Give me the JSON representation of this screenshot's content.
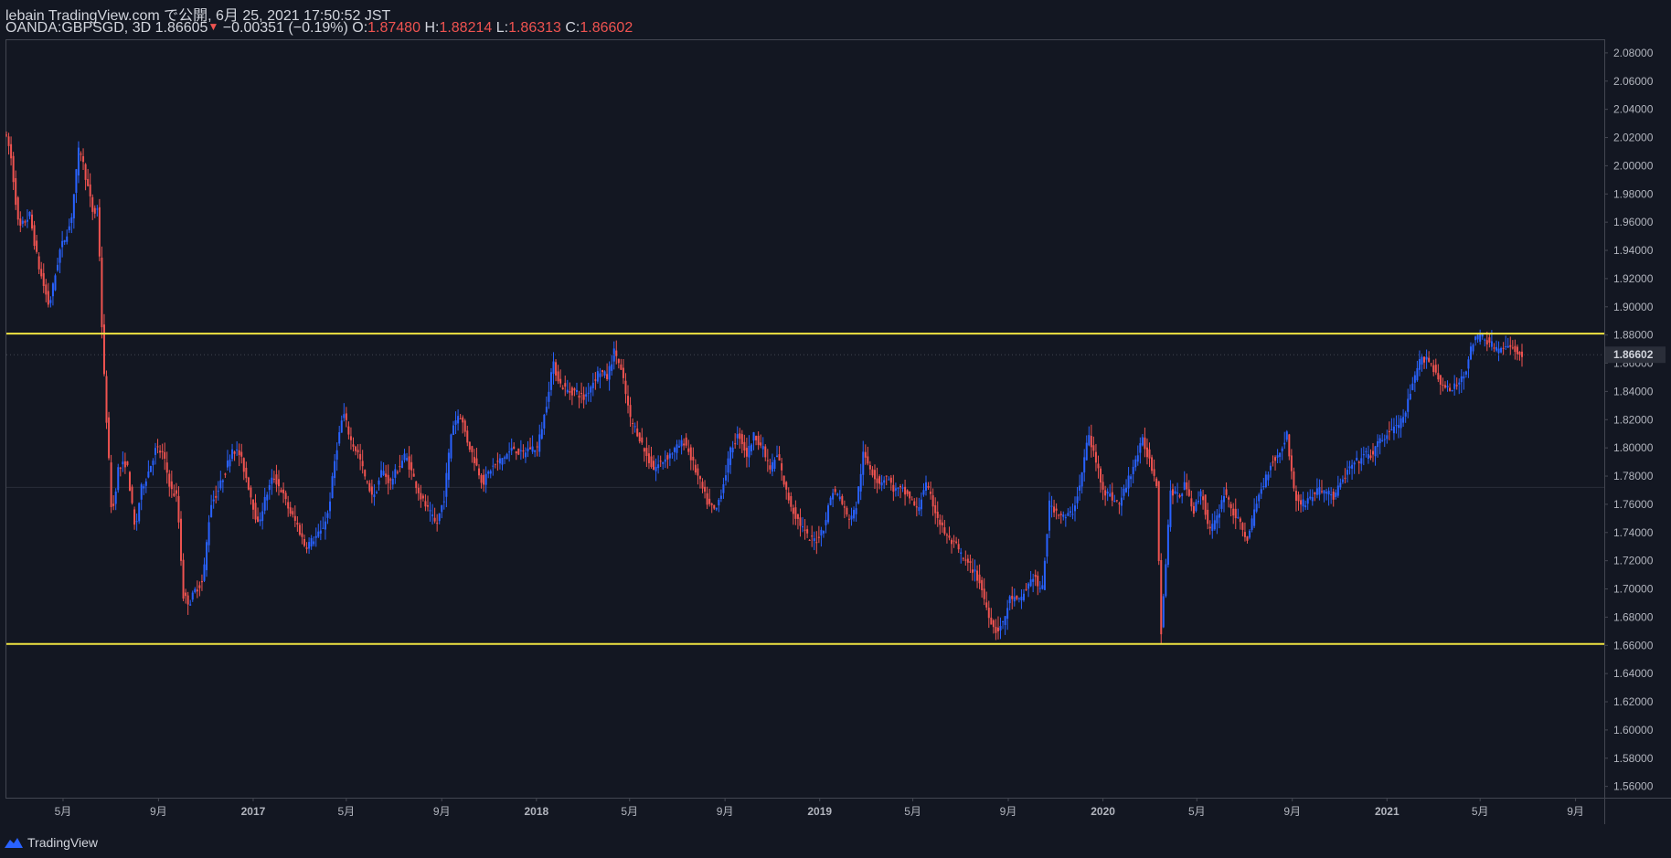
{
  "header": {
    "publish_line": "lebain TradingView.com で公開, 6月 25, 2021 17:50:52 JST",
    "symbol": "OANDA:GBPSGD, 3D",
    "last": "1.86605",
    "change": "−0.00351 (−0.19%)",
    "o_label": "O:",
    "o_value": "1.87480",
    "h_label": "H:",
    "h_value": "1.88214",
    "l_label": "L:",
    "l_value": "1.86313",
    "c_label": "C:",
    "c_value": "1.86602"
  },
  "footer": {
    "brand": "TradingView",
    "logo_icon": "tradingview-logo-icon"
  },
  "colors": {
    "background": "#131722",
    "up": "#2962ff",
    "down": "#ef5350",
    "level_line": "#f0e442",
    "text": "#d1d4dc",
    "border": "#434651"
  },
  "chart_data": {
    "type": "candlestick",
    "symbol": "OANDA:GBPSGD",
    "interval": "3D",
    "ylim": [
      1.552,
      2.089
    ],
    "y_ticks": [
      "2.08000",
      "2.06000",
      "2.04000",
      "2.02000",
      "2.00000",
      "1.98000",
      "1.96000",
      "1.94000",
      "1.92000",
      "1.90000",
      "1.88000",
      "1.86000",
      "1.84000",
      "1.82000",
      "1.80000",
      "1.78000",
      "1.76000",
      "1.74000",
      "1.72000",
      "1.70000",
      "1.68000",
      "1.66000",
      "1.64000",
      "1.62000",
      "1.60000",
      "1.58000",
      "1.56000"
    ],
    "x_ticks": [
      {
        "label": "5月",
        "date": "2016-05-01"
      },
      {
        "label": "9月",
        "date": "2016-09-01"
      },
      {
        "label": "2017",
        "date": "2017-01-01"
      },
      {
        "label": "5月",
        "date": "2017-05-01"
      },
      {
        "label": "9月",
        "date": "2017-09-01"
      },
      {
        "label": "2018",
        "date": "2018-01-01"
      },
      {
        "label": "5月",
        "date": "2018-05-01"
      },
      {
        "label": "9月",
        "date": "2018-09-01"
      },
      {
        "label": "2019",
        "date": "2019-01-01"
      },
      {
        "label": "5月",
        "date": "2019-05-01"
      },
      {
        "label": "9月",
        "date": "2019-09-01"
      },
      {
        "label": "2020",
        "date": "2020-01-01"
      },
      {
        "label": "5月",
        "date": "2020-05-01"
      },
      {
        "label": "9月",
        "date": "2020-09-01"
      },
      {
        "label": "2021",
        "date": "2021-01-01"
      },
      {
        "label": "5月",
        "date": "2021-05-01"
      },
      {
        "label": "9月",
        "date": "2021-09-01"
      }
    ],
    "x_range": [
      "2016-02-18",
      "2021-10-08"
    ],
    "last_date": "2021-06-25",
    "last_price_label": "1.86602",
    "horizontal_lines": [
      1.881,
      1.661
    ],
    "price_path": [
      [
        "2016-02-18",
        2.025
      ],
      [
        "2016-02-26",
        2.01
      ],
      [
        "2016-03-08",
        1.955
      ],
      [
        "2016-03-22",
        1.965
      ],
      [
        "2016-04-02",
        1.93
      ],
      [
        "2016-04-16",
        1.9
      ],
      [
        "2016-04-30",
        1.94
      ],
      [
        "2016-05-14",
        1.96
      ],
      [
        "2016-05-25",
        2.015
      ],
      [
        "2016-06-03",
        1.99
      ],
      [
        "2016-06-12",
        1.965
      ],
      [
        "2016-06-18",
        1.97
      ],
      [
        "2016-06-24",
        1.87
      ],
      [
        "2016-06-30",
        1.81
      ],
      [
        "2016-07-06",
        1.75
      ],
      [
        "2016-07-14",
        1.785
      ],
      [
        "2016-07-25",
        1.79
      ],
      [
        "2016-08-05",
        1.74
      ],
      [
        "2016-08-12",
        1.77
      ],
      [
        "2016-08-20",
        1.78
      ],
      [
        "2016-09-01",
        1.8
      ],
      [
        "2016-09-10",
        1.795
      ],
      [
        "2016-09-20",
        1.77
      ],
      [
        "2016-09-28",
        1.765
      ],
      [
        "2016-10-06",
        1.695
      ],
      [
        "2016-10-14",
        1.69
      ],
      [
        "2016-10-22",
        1.7
      ],
      [
        "2016-10-31",
        1.705
      ],
      [
        "2016-11-10",
        1.76
      ],
      [
        "2016-11-20",
        1.77
      ],
      [
        "2016-11-30",
        1.785
      ],
      [
        "2016-12-08",
        1.8
      ],
      [
        "2016-12-18",
        1.795
      ],
      [
        "2016-12-28",
        1.775
      ],
      [
        "2017-01-10",
        1.745
      ],
      [
        "2017-01-20",
        1.765
      ],
      [
        "2017-01-30",
        1.78
      ],
      [
        "2017-02-09",
        1.77
      ],
      [
        "2017-02-20",
        1.755
      ],
      [
        "2017-03-02",
        1.745
      ],
      [
        "2017-03-12",
        1.73
      ],
      [
        "2017-03-22",
        1.735
      ],
      [
        "2017-04-01",
        1.74
      ],
      [
        "2017-04-11",
        1.755
      ],
      [
        "2017-04-20",
        1.795
      ],
      [
        "2017-04-30",
        1.825
      ],
      [
        "2017-05-10",
        1.805
      ],
      [
        "2017-05-20",
        1.795
      ],
      [
        "2017-05-30",
        1.775
      ],
      [
        "2017-06-09",
        1.765
      ],
      [
        "2017-06-19",
        1.785
      ],
      [
        "2017-06-29",
        1.775
      ],
      [
        "2017-07-09",
        1.785
      ],
      [
        "2017-07-19",
        1.795
      ],
      [
        "2017-07-29",
        1.78
      ],
      [
        "2017-08-08",
        1.765
      ],
      [
        "2017-08-18",
        1.755
      ],
      [
        "2017-08-28",
        1.745
      ],
      [
        "2017-09-07",
        1.765
      ],
      [
        "2017-09-17",
        1.815
      ],
      [
        "2017-09-27",
        1.825
      ],
      [
        "2017-10-07",
        1.805
      ],
      [
        "2017-10-17",
        1.79
      ],
      [
        "2017-10-27",
        1.775
      ],
      [
        "2017-11-06",
        1.785
      ],
      [
        "2017-11-16",
        1.79
      ],
      [
        "2017-11-26",
        1.795
      ],
      [
        "2017-12-06",
        1.8
      ],
      [
        "2017-12-16",
        1.795
      ],
      [
        "2017-12-26",
        1.8
      ],
      [
        "2018-01-05",
        1.8
      ],
      [
        "2018-01-15",
        1.825
      ],
      [
        "2018-01-25",
        1.86
      ],
      [
        "2018-02-04",
        1.845
      ],
      [
        "2018-02-14",
        1.84
      ],
      [
        "2018-02-24",
        1.84
      ],
      [
        "2018-03-06",
        1.835
      ],
      [
        "2018-03-16",
        1.845
      ],
      [
        "2018-03-26",
        1.855
      ],
      [
        "2018-04-05",
        1.85
      ],
      [
        "2018-04-15",
        1.87
      ],
      [
        "2018-04-25",
        1.85
      ],
      [
        "2018-05-05",
        1.82
      ],
      [
        "2018-05-15",
        1.81
      ],
      [
        "2018-05-25",
        1.795
      ],
      [
        "2018-06-04",
        1.785
      ],
      [
        "2018-06-14",
        1.79
      ],
      [
        "2018-06-24",
        1.795
      ],
      [
        "2018-07-04",
        1.8
      ],
      [
        "2018-07-14",
        1.805
      ],
      [
        "2018-07-24",
        1.79
      ],
      [
        "2018-08-03",
        1.775
      ],
      [
        "2018-08-13",
        1.76
      ],
      [
        "2018-08-23",
        1.755
      ],
      [
        "2018-09-02",
        1.775
      ],
      [
        "2018-09-12",
        1.8
      ],
      [
        "2018-09-22",
        1.81
      ],
      [
        "2018-10-02",
        1.795
      ],
      [
        "2018-10-12",
        1.81
      ],
      [
        "2018-10-22",
        1.8
      ],
      [
        "2018-11-01",
        1.785
      ],
      [
        "2018-11-11",
        1.795
      ],
      [
        "2018-11-21",
        1.77
      ],
      [
        "2018-12-01",
        1.755
      ],
      [
        "2018-12-11",
        1.745
      ],
      [
        "2018-12-21",
        1.735
      ],
      [
        "2018-12-31",
        1.735
      ],
      [
        "2019-01-10",
        1.745
      ],
      [
        "2019-01-20",
        1.77
      ],
      [
        "2019-01-30",
        1.765
      ],
      [
        "2019-02-09",
        1.75
      ],
      [
        "2019-02-19",
        1.755
      ],
      [
        "2019-03-01",
        1.795
      ],
      [
        "2019-03-11",
        1.785
      ],
      [
        "2019-03-21",
        1.775
      ],
      [
        "2019-03-31",
        1.78
      ],
      [
        "2019-04-10",
        1.77
      ],
      [
        "2019-04-20",
        1.77
      ],
      [
        "2019-04-30",
        1.765
      ],
      [
        "2019-05-10",
        1.755
      ],
      [
        "2019-05-20",
        1.775
      ],
      [
        "2019-05-30",
        1.76
      ],
      [
        "2019-06-09",
        1.745
      ],
      [
        "2019-06-19",
        1.735
      ],
      [
        "2019-06-29",
        1.73
      ],
      [
        "2019-07-09",
        1.72
      ],
      [
        "2019-07-19",
        1.715
      ],
      [
        "2019-07-29",
        1.705
      ],
      [
        "2019-08-08",
        1.685
      ],
      [
        "2019-08-18",
        1.67
      ],
      [
        "2019-08-28",
        1.675
      ],
      [
        "2019-09-07",
        1.695
      ],
      [
        "2019-09-17",
        1.69
      ],
      [
        "2019-09-27",
        1.7
      ],
      [
        "2019-10-07",
        1.71
      ],
      [
        "2019-10-17",
        1.695
      ],
      [
        "2019-10-27",
        1.76
      ],
      [
        "2019-11-06",
        1.755
      ],
      [
        "2019-11-16",
        1.75
      ],
      [
        "2019-11-26",
        1.755
      ],
      [
        "2019-12-06",
        1.775
      ],
      [
        "2019-12-16",
        1.81
      ],
      [
        "2019-12-26",
        1.79
      ],
      [
        "2020-01-05",
        1.77
      ],
      [
        "2020-01-15",
        1.765
      ],
      [
        "2020-01-25",
        1.76
      ],
      [
        "2020-02-04",
        1.775
      ],
      [
        "2020-02-14",
        1.79
      ],
      [
        "2020-02-24",
        1.805
      ],
      [
        "2020-03-05",
        1.79
      ],
      [
        "2020-03-13",
        1.775
      ],
      [
        "2020-03-19",
        1.67
      ],
      [
        "2020-03-25",
        1.72
      ],
      [
        "2020-03-31",
        1.77
      ],
      [
        "2020-04-10",
        1.765
      ],
      [
        "2020-04-20",
        1.775
      ],
      [
        "2020-04-30",
        1.755
      ],
      [
        "2020-05-10",
        1.77
      ],
      [
        "2020-05-20",
        1.74
      ],
      [
        "2020-05-30",
        1.75
      ],
      [
        "2020-06-09",
        1.77
      ],
      [
        "2020-06-19",
        1.755
      ],
      [
        "2020-06-29",
        1.745
      ],
      [
        "2020-07-09",
        1.735
      ],
      [
        "2020-07-19",
        1.76
      ],
      [
        "2020-07-29",
        1.775
      ],
      [
        "2020-08-08",
        1.79
      ],
      [
        "2020-08-18",
        1.795
      ],
      [
        "2020-08-28",
        1.81
      ],
      [
        "2020-09-07",
        1.765
      ],
      [
        "2020-09-17",
        1.76
      ],
      [
        "2020-09-27",
        1.765
      ],
      [
        "2020-10-07",
        1.77
      ],
      [
        "2020-10-17",
        1.77
      ],
      [
        "2020-10-27",
        1.765
      ],
      [
        "2020-11-06",
        1.775
      ],
      [
        "2020-11-16",
        1.785
      ],
      [
        "2020-11-26",
        1.79
      ],
      [
        "2020-12-06",
        1.795
      ],
      [
        "2020-12-16",
        1.795
      ],
      [
        "2020-12-26",
        1.805
      ],
      [
        "2021-01-05",
        1.81
      ],
      [
        "2021-01-15",
        1.815
      ],
      [
        "2021-01-25",
        1.82
      ],
      [
        "2021-02-04",
        1.84
      ],
      [
        "2021-02-14",
        1.86
      ],
      [
        "2021-02-24",
        1.865
      ],
      [
        "2021-03-06",
        1.855
      ],
      [
        "2021-03-16",
        1.845
      ],
      [
        "2021-03-26",
        1.84
      ],
      [
        "2021-04-05",
        1.845
      ],
      [
        "2021-04-15",
        1.855
      ],
      [
        "2021-04-25",
        1.875
      ],
      [
        "2021-05-05",
        1.88
      ],
      [
        "2021-05-15",
        1.875
      ],
      [
        "2021-05-25",
        1.87
      ],
      [
        "2021-06-04",
        1.87
      ],
      [
        "2021-06-14",
        1.872
      ],
      [
        "2021-06-25",
        1.866
      ]
    ]
  }
}
